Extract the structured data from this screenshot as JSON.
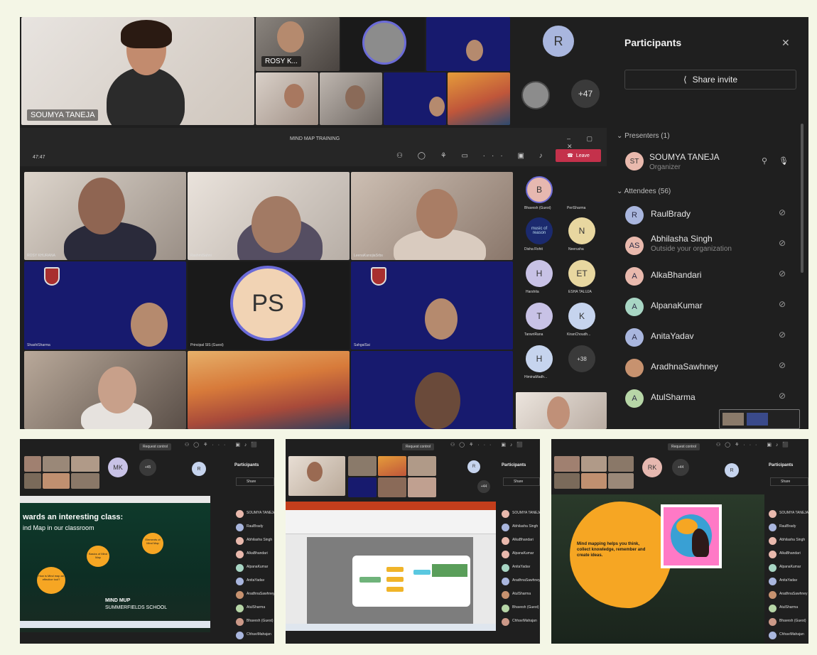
{
  "main": {
    "participants_title": "Participants",
    "share_invite": "Share invite",
    "presenters_header": "Presenters (1)",
    "attendees_header": "Attendees (56)",
    "presenter": {
      "initials": "ST",
      "name": "SOUMYA TANEJA",
      "role": "Organizer"
    },
    "attendees": [
      {
        "initials": "R",
        "name": "RaulBrady",
        "sub": "",
        "color": "#a9b6de"
      },
      {
        "initials": "AS",
        "name": "Abhilasha Singh",
        "sub": "Outside your organization",
        "color": "#e9b9ad"
      },
      {
        "initials": "A",
        "name": "AlkaBhandari",
        "sub": "",
        "color": "#e9b9ad"
      },
      {
        "initials": "A",
        "name": "AlpanaKumar",
        "sub": "",
        "color": "#a8d6c4"
      },
      {
        "initials": "A",
        "name": "AnitaYadav",
        "sub": "",
        "color": "#a9b6de"
      },
      {
        "initials": "",
        "name": "AradhnaSawhney",
        "sub": "",
        "color": "#c7926f"
      },
      {
        "initials": "A",
        "name": "AtulSharma",
        "sub": "",
        "color": "#b7d6a7"
      }
    ],
    "top_tiles": {
      "soumya": "SOUMYA TANEJA",
      "rosy": "ROSY K...",
      "r_avatar": "R",
      "plus_count": "+47"
    },
    "inner": {
      "title": "MIND MAP TRAINING",
      "timer": "47:47",
      "leave": "Leave",
      "ps_initials": "PS",
      "names": {
        "t1": "ROSY KHURANA",
        "t2": "RashmiSahni",
        "t3": "LeenaKanojiaSrbs",
        "t4": "ShashiSharma",
        "t5": "Principal SIS (Guest)",
        "t6": "SahgalSai"
      },
      "side": [
        {
          "i": "B",
          "n": "Bhavesh (Guest)",
          "c": "#e6b8b0"
        },
        {
          "i": "",
          "n": "PeriSharma",
          "c": ""
        },
        {
          "i": "",
          "n": "Disha Rohit",
          "c": ""
        },
        {
          "i": "N",
          "n": "Neerusha",
          "c": "#e8d7a0"
        },
        {
          "i": "H",
          "n": "Harshita",
          "c": "#c8c2e6"
        },
        {
          "i": "ET",
          "n": "ESHA TALUJA",
          "c": "#e8d7a0"
        },
        {
          "i": "T",
          "n": "TanwriRana",
          "c": "#c8c2e6"
        },
        {
          "i": "K",
          "n": "KiranChoudh...",
          "c": "#c6d4ee"
        },
        {
          "i": "H",
          "n": "HiminaMadh...",
          "c": "#c6d4ee"
        },
        {
          "i": "",
          "n": "+38",
          "c": ""
        }
      ],
      "music_text": "music of reason"
    }
  },
  "panel1": {
    "request_control": "Request control",
    "participants": "Participants",
    "share": "Share",
    "mk": "MK",
    "r": "R",
    "plus": "+45",
    "slide_title": "wards an interesting class:",
    "slide_sub": "ind Map in our classroom",
    "blob1": "How is Mind map an effective tool?",
    "blob2": "Basics of Mind Map",
    "blob3": "Elements of Mind Map",
    "footer1": "MIND MUP",
    "footer2": "SUMMERFIELDS SCHOOL",
    "rows": [
      "SOUMYA TANEJA",
      "RaulBrady",
      "Abhilasha Singh",
      "AlkaBhandari",
      "AlpanaKumar",
      "AnitaYadav",
      "AradhnaSawhney",
      "AtulSharma",
      "Bhavesh (Guest)",
      "ChhaviMahajan"
    ]
  },
  "panel2": {
    "request_control": "Request control",
    "participants": "Participants",
    "share": "Share",
    "r": "R",
    "plus": "+44",
    "rows": [
      "SOUMYA TANEJA",
      "Abhilasha Singh",
      "AlkaBhandari",
      "AlpanaKumar",
      "AnitaYadav",
      "AradhnaSawhney",
      "AtulSharma",
      "Bhavesh (Guest)",
      "ChhaviMahajan"
    ]
  },
  "panel3": {
    "request_control": "Request control",
    "participants": "Participants",
    "share": "Share",
    "rk": "RK",
    "r": "R",
    "plus": "+44",
    "slide_text": "Mind mapping helps you think, collect knowledge, remember and create ideas.",
    "rows": [
      "SOUMYA TANEJA",
      "RaulBrady",
      "Abhilasha Singh",
      "AlkaBhandari",
      "AlpanaKumar",
      "AnitaYadav",
      "AradhnaSawhney",
      "AtulSharma",
      "Bhavesh (Guest)",
      "ChhaviMahajan"
    ]
  },
  "colors": {
    "teams_bg": "#1f1f1f",
    "panel_bg": "#292929",
    "leave_red": "#c4314b",
    "navy_tile": "#171a6e"
  }
}
